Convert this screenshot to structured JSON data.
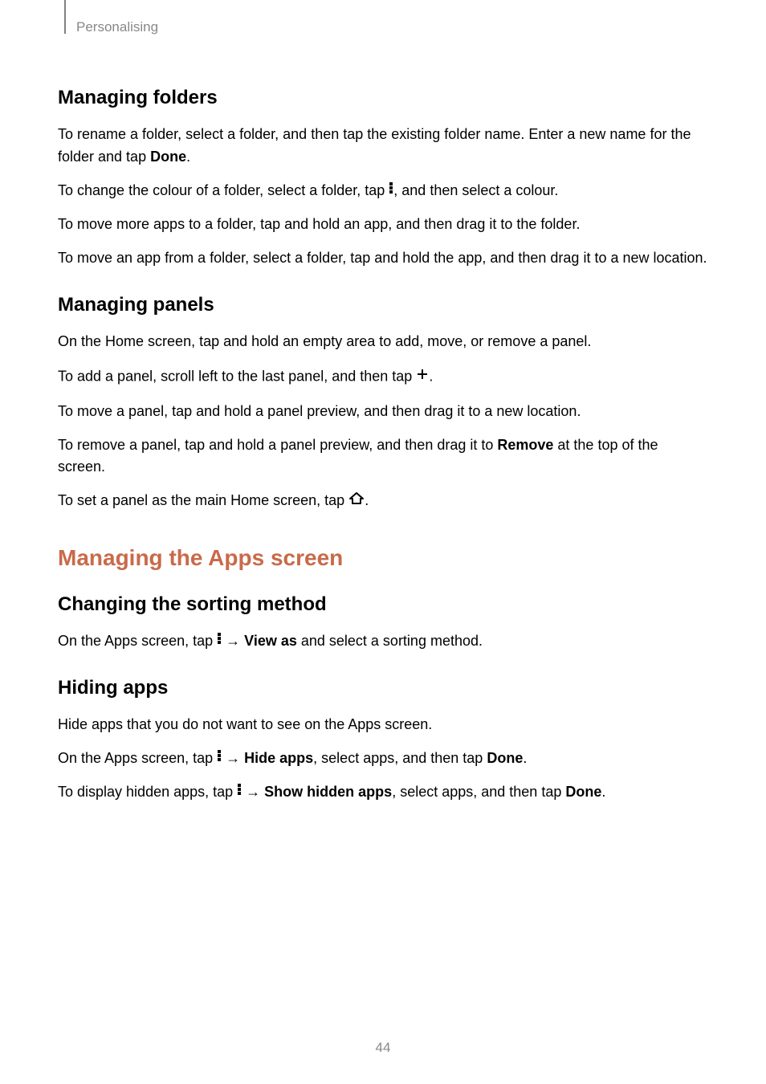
{
  "chapter": "Personalising",
  "section1": {
    "heading": "Managing folders",
    "p1_a": "To rename a folder, select a folder, and then tap the existing folder name. Enter a new name for the folder and tap ",
    "p1_b": "Done",
    "p1_c": ".",
    "p2_a": "To change the colour of a folder, select a folder, tap ",
    "p2_b": ", and then select a colour.",
    "p3": "To move more apps to a folder, tap and hold an app, and then drag it to the folder.",
    "p4": "To move an app from a folder, select a folder, tap and hold the app, and then drag it to a new location."
  },
  "section2": {
    "heading": "Managing panels",
    "p1": "On the Home screen, tap and hold an empty area to add, move, or remove a panel.",
    "p2_a": "To add a panel, scroll left to the last panel, and then tap ",
    "p2_b": ".",
    "p3": "To move a panel, tap and hold a panel preview, and then drag it to a new location.",
    "p4_a": "To remove a panel, tap and hold a panel preview, and then drag it to ",
    "p4_b": "Remove",
    "p4_c": " at the top of the screen.",
    "p5_a": "To set a panel as the main Home screen, tap ",
    "p5_b": "."
  },
  "section3": {
    "heading": "Managing the Apps screen",
    "sub1": {
      "heading": "Changing the sorting method",
      "p1_a": "On the Apps screen, tap ",
      "p1_arrow": " → ",
      "p1_b": "View as",
      "p1_c": " and select a sorting method."
    },
    "sub2": {
      "heading": "Hiding apps",
      "p1": "Hide apps that you do not want to see on the Apps screen.",
      "p2_a": "On the Apps screen, tap ",
      "p2_arrow": " → ",
      "p2_b": "Hide apps",
      "p2_c": ", select apps, and then tap ",
      "p2_d": "Done",
      "p2_e": ".",
      "p3_a": "To display hidden apps, tap ",
      "p3_arrow": " → ",
      "p3_b": "Show hidden apps",
      "p3_c": ", select apps, and then tap ",
      "p3_d": "Done",
      "p3_e": "."
    }
  },
  "pageNumber": "44"
}
